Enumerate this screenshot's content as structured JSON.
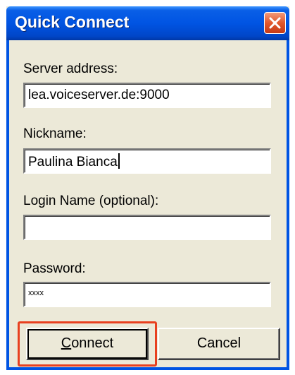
{
  "window": {
    "title": "Quick Connect"
  },
  "form": {
    "server_label": "Server address:",
    "server_value": "lea.voiceserver.de:9000",
    "nickname_label": "Nickname:",
    "nickname_value": "Paulina Bianca",
    "login_label": "Login Name (optional):",
    "login_value": "",
    "password_label": "Password:",
    "password_value": "xxxx"
  },
  "buttons": {
    "connect_accel": "C",
    "connect_rest": "onnect",
    "cancel": "Cancel"
  },
  "icons": {
    "close": "close-icon"
  },
  "colors": {
    "titlebar": "#0054e3",
    "dialog_bg": "#ece9d8",
    "close_button": "#e2572c",
    "highlight": "#e8401f"
  }
}
